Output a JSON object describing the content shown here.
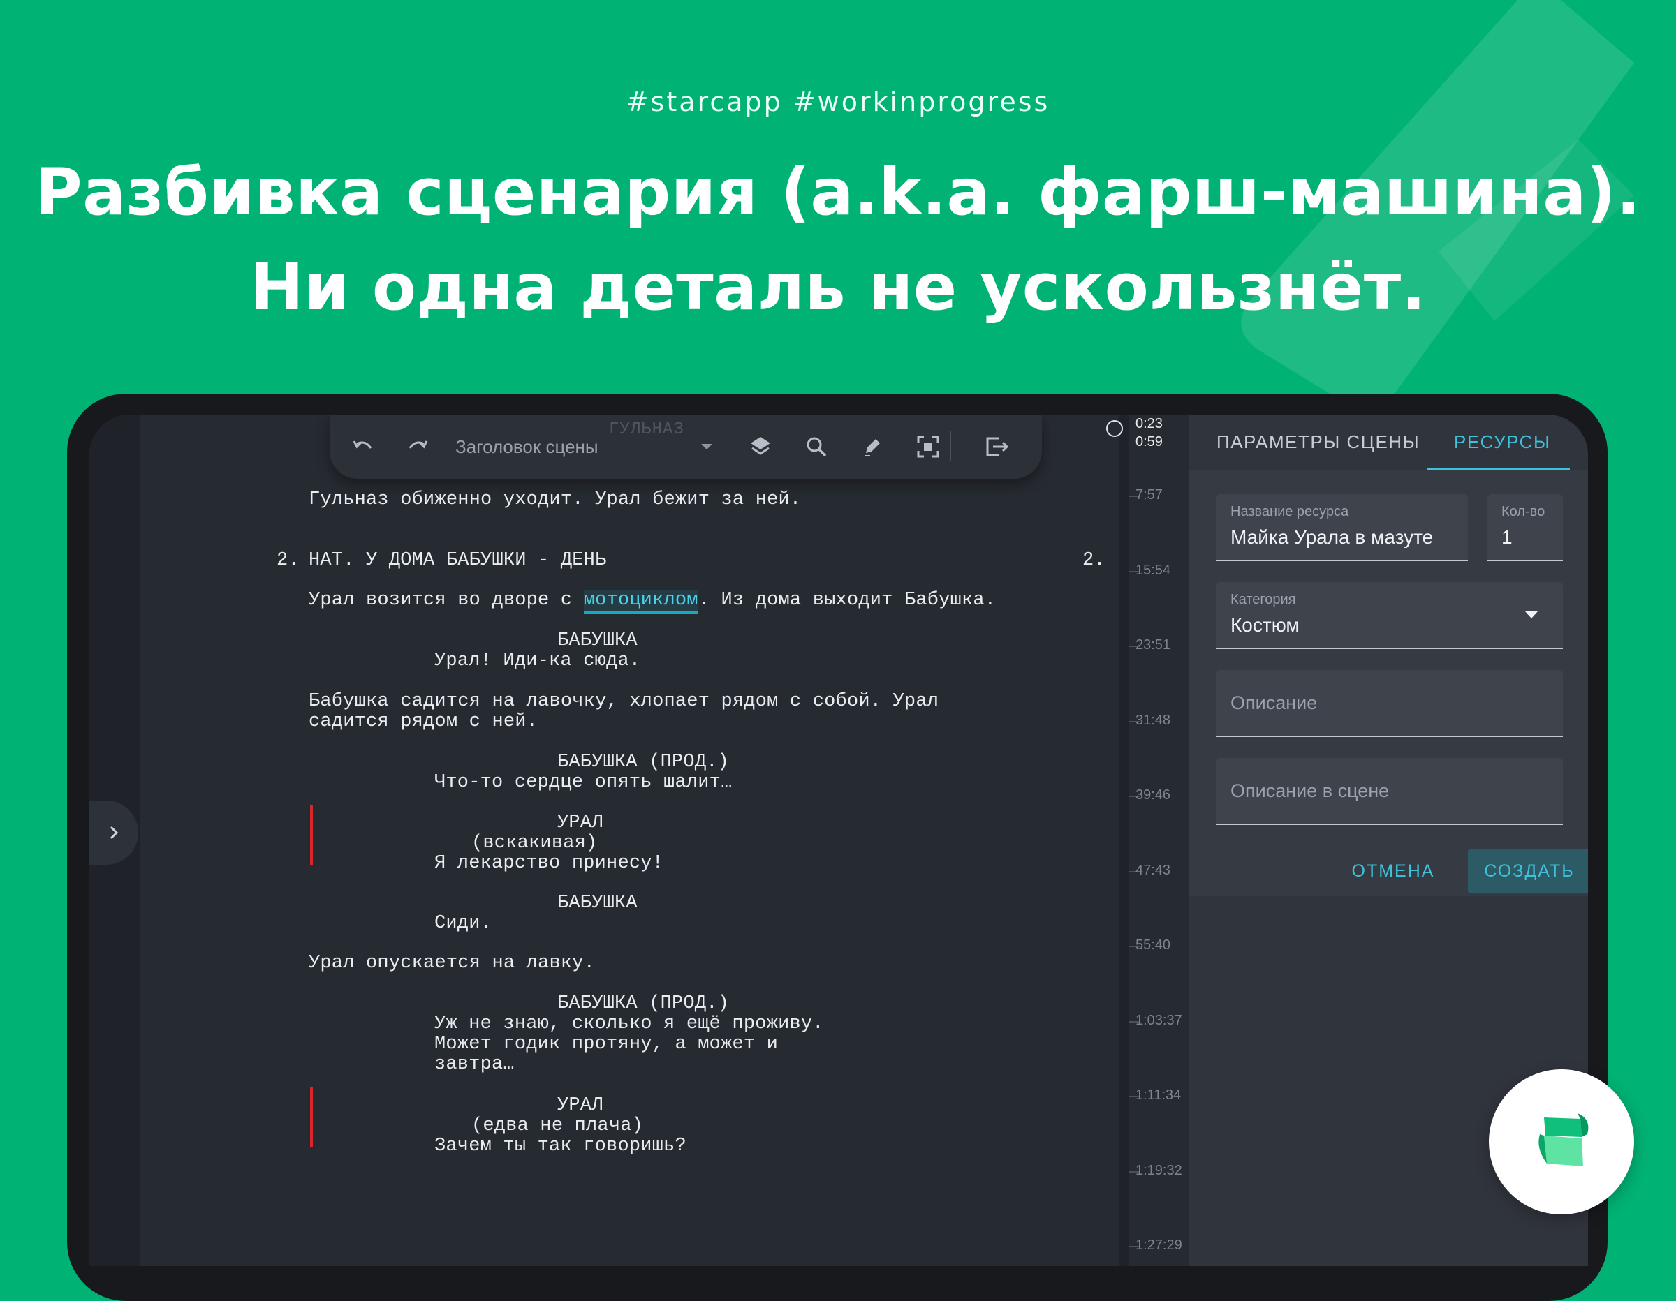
{
  "banner": {
    "hashtags": "#starcapp  #workinprogress",
    "headline_line1": "Разбивка сценария (a.k.a. фарш-машина).",
    "headline_line2": "Ни одна деталь не ускользнёт."
  },
  "toolbar": {
    "heading_select": "Заголовок сцены",
    "ghost_character": "ГУЛЬНАЗ",
    "icons": [
      "undo-icon",
      "redo-icon",
      "chevron-down-icon",
      "layers-icon",
      "search-icon",
      "pen-icon",
      "focus-icon",
      "exit-icon"
    ]
  },
  "script": {
    "action_1": "Гульназ обиженно уходит. Урал бежит за ней.",
    "scene_number_left": "2.",
    "scene_heading": "НАТ. У ДОМА БАБУШКИ - ДЕНЬ",
    "scene_number_right": "2.",
    "action_2_before": "Урал возится во дворе с ",
    "action_2_highlight": "мотоциклом",
    "action_2_after": ". Из дома выходит Бабушка.",
    "char_1": "БАБУШКА",
    "dial_1": "Урал! Иди-ка сюда.",
    "action_3_l1": "Бабушка садится на лавочку, хлопает рядом с собой. Урал",
    "action_3_l2": "садится рядом с ней.",
    "char_2": "БАБУШКА (ПРОД.)",
    "dial_2": "Что-то сердце опять шалит…",
    "char_3": "УРАЛ",
    "paren_3": "(вскакивая)",
    "dial_3": "Я лекарство принесу!",
    "char_4": "БАБУШКА",
    "dial_4": "Сиди.",
    "action_4": "Урал опускается на лавку.",
    "char_5": "БАБУШКА (ПРОД.)",
    "dial_5_l1": "Уж не знаю, сколько я ещё проживу.",
    "dial_5_l2": "Может годик протяну, а может и",
    "dial_5_l3": "завтра…",
    "char_6": "УРАЛ",
    "paren_6": "(едва не плача)",
    "dial_6": "Зачем ты так говоришь?"
  },
  "timeline": {
    "current_1": "0:23",
    "current_2": "0:59",
    "marks": [
      "7:57",
      "15:54",
      "23:51",
      "31:48",
      "39:46",
      "47:43",
      "55:40",
      "1:03:37",
      "1:11:34",
      "1:19:32",
      "1:27:29"
    ]
  },
  "panel": {
    "tab_scene_params": "ПАРАМЕТРЫ СЦЕНЫ",
    "tab_resources": "РЕСУРСЫ",
    "resource_name_label": "Название ресурса",
    "resource_name_value": "Майка Урала в мазуте",
    "qty_label": "Кол-во",
    "qty_value": "1",
    "category_label": "Категория",
    "category_value": "Костюм",
    "description_placeholder": "Описание",
    "scene_description_placeholder": "Описание в сцене",
    "cancel_label": "ОТМЕНА",
    "create_label": "СОЗДАТЬ"
  },
  "colors": {
    "brand_green": "#00b274",
    "accent_cyan": "#3fc1d9",
    "revision_red": "#d8262e",
    "editor_bg": "#262a31"
  }
}
